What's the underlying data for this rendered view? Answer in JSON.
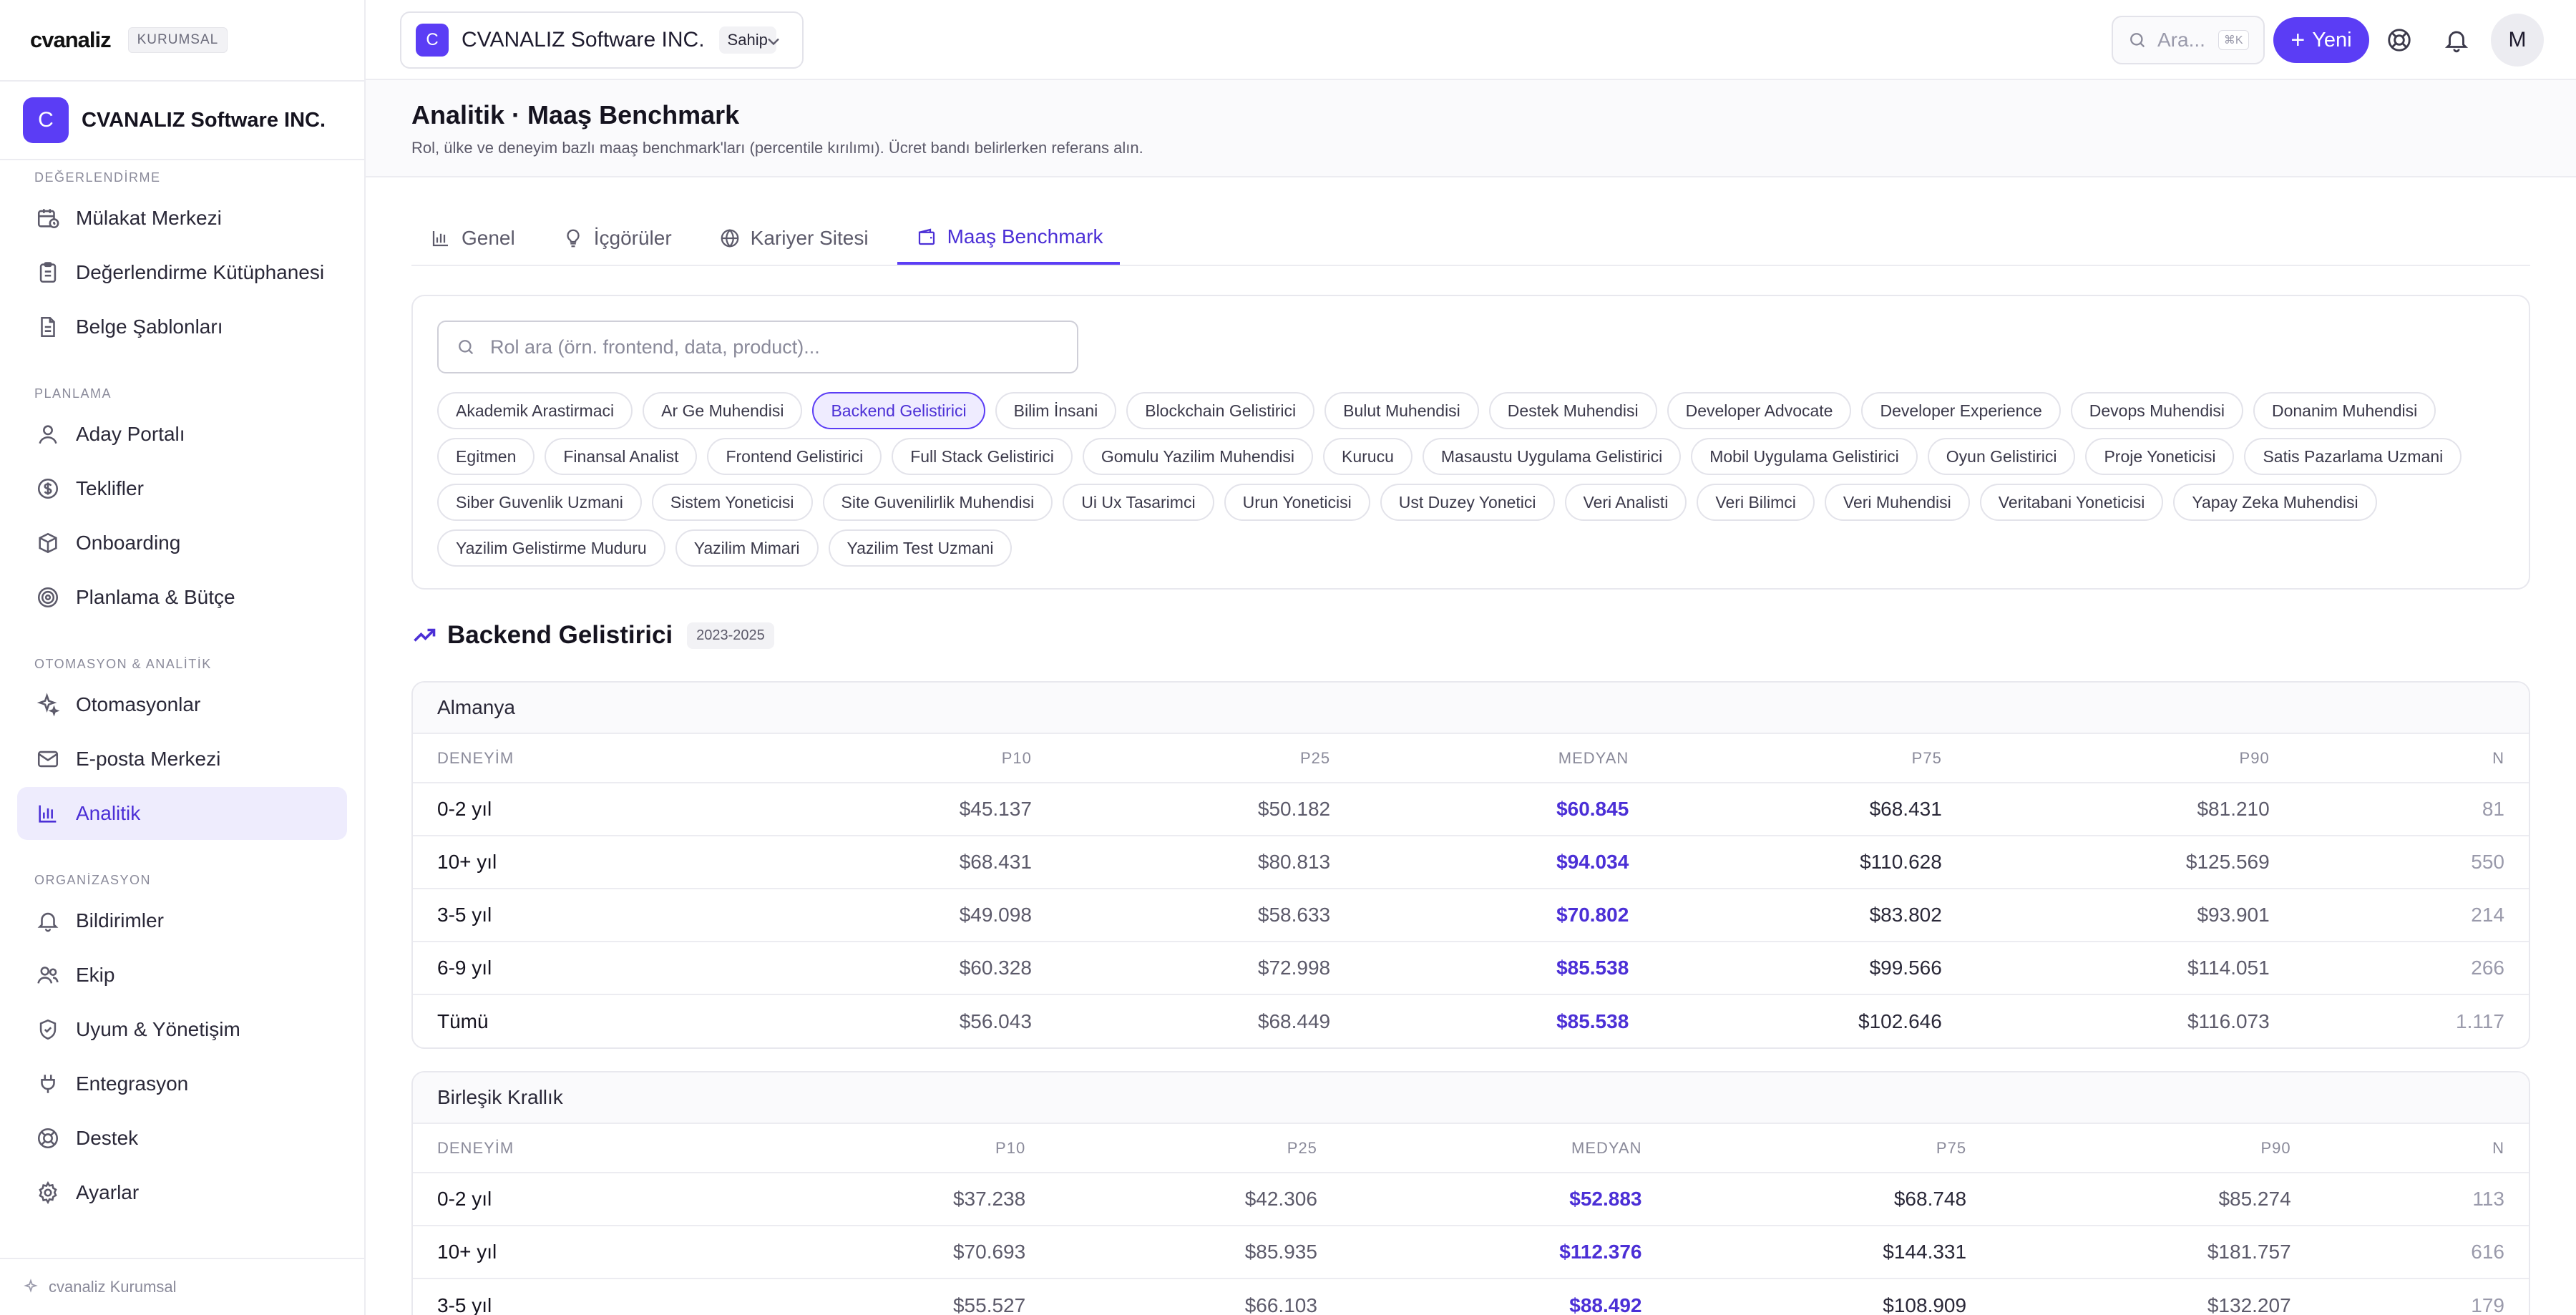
{
  "brand": {
    "logo": "cvanaliz",
    "badge": "KURUMSAL"
  },
  "org": {
    "initial": "C",
    "name": "CVANALIZ Software INC."
  },
  "sidebar": {
    "sections": [
      {
        "title": "DEĞERLENDİRME",
        "items": [
          {
            "label": "Mülakat Merkezi",
            "icon": "calendar-clock-icon"
          },
          {
            "label": "Değerlendirme Kütüphanesi",
            "icon": "clipboard-icon"
          },
          {
            "label": "Belge Şablonları",
            "icon": "document-icon"
          }
        ]
      },
      {
        "title": "PLANLAMA",
        "items": [
          {
            "label": "Aday Portalı",
            "icon": "user-icon"
          },
          {
            "label": "Teklifler",
            "icon": "dollar-circle-icon"
          },
          {
            "label": "Onboarding",
            "icon": "box-icon"
          },
          {
            "label": "Planlama & Bütçe",
            "icon": "target-icon"
          }
        ]
      },
      {
        "title": "OTOMASYON & ANALİTİK",
        "items": [
          {
            "label": "Otomasyonlar",
            "icon": "sparkles-icon"
          },
          {
            "label": "E-posta Merkezi",
            "icon": "mail-icon"
          },
          {
            "label": "Analitik",
            "icon": "bar-chart-icon",
            "active": true
          }
        ]
      },
      {
        "title": "ORGANİZASYON",
        "items": [
          {
            "label": "Bildirimler",
            "icon": "bell-icon"
          },
          {
            "label": "Ekip",
            "icon": "users-icon"
          },
          {
            "label": "Uyum & Yönetişim",
            "icon": "shield-icon"
          },
          {
            "label": "Entegrasyon",
            "icon": "plug-icon"
          },
          {
            "label": "Destek",
            "icon": "lifebuoy-icon"
          },
          {
            "label": "Ayarlar",
            "icon": "gear-icon"
          }
        ]
      }
    ],
    "footer": "cvanaliz Kurumsal"
  },
  "topbar": {
    "workspace_initial": "C",
    "workspace_name": "CVANALIZ Software INC.",
    "workspace_role": "Sahip",
    "search_placeholder": "Ara...",
    "search_shortcut": "⌘K",
    "new_label": "Yeni",
    "user_initial": "M"
  },
  "page": {
    "title": "Analitik · Maaş Benchmark",
    "subtitle": "Rol, ülke ve deneyim bazlı maaş benchmark'ları (percentile kırılımı). Ücret bandı belirlerken referans alın."
  },
  "tabs": [
    {
      "label": "Genel",
      "icon": "bar-chart-icon"
    },
    {
      "label": "İçgörüler",
      "icon": "lightbulb-icon"
    },
    {
      "label": "Kariyer Sitesi",
      "icon": "globe-icon"
    },
    {
      "label": "Maaş Benchmark",
      "icon": "wallet-icon",
      "active": true
    }
  ],
  "roles": {
    "search_placeholder": "Rol ara (örn. frontend, data, product)...",
    "selected": "Backend Gelistirici",
    "list": [
      "Akademik Arastirmaci",
      "Ar Ge Muhendisi",
      "Backend Gelistirici",
      "Bilim İnsani",
      "Blockchain Gelistirici",
      "Bulut Muhendisi",
      "Destek Muhendisi",
      "Developer Advocate",
      "Developer Experience",
      "Devops Muhendisi",
      "Donanim Muhendisi",
      "Egitmen",
      "Finansal Analist",
      "Frontend Gelistirici",
      "Full Stack Gelistirici",
      "Gomulu Yazilim Muhendisi",
      "Kurucu",
      "Masaustu Uygulama Gelistirici",
      "Mobil Uygulama Gelistirici",
      "Oyun Gelistirici",
      "Proje Yoneticisi",
      "Satis Pazarlama Uzmani",
      "Siber Guvenlik Uzmani",
      "Sistem Yoneticisi",
      "Site Guvenilirlik Muhendisi",
      "Ui Ux Tasarimci",
      "Urun Yoneticisi",
      "Ust Duzey Yonetici",
      "Veri Analisti",
      "Veri Bilimci",
      "Veri Muhendisi",
      "Veritabani Yoneticisi",
      "Yapay Zeka Muhendisi",
      "Yazilim Gelistirme Muduru",
      "Yazilim Mimari",
      "Yazilim Test Uzmani"
    ]
  },
  "benchmark": {
    "role_title": "Backend Gelistirici",
    "period": "2023-2025",
    "columns": [
      "DENEYİM",
      "P10",
      "P25",
      "MEDYAN",
      "P75",
      "P90",
      "N"
    ],
    "countries": [
      {
        "name": "Almanya",
        "rows": [
          [
            "0-2 yıl",
            "$45.137",
            "$50.182",
            "$60.845",
            "$68.431",
            "$81.210",
            "81"
          ],
          [
            "10+ yıl",
            "$68.431",
            "$80.813",
            "$94.034",
            "$110.628",
            "$125.569",
            "550"
          ],
          [
            "3-5 yıl",
            "$49.098",
            "$58.633",
            "$70.802",
            "$83.802",
            "$93.901",
            "214"
          ],
          [
            "6-9 yıl",
            "$60.328",
            "$72.998",
            "$85.538",
            "$99.566",
            "$114.051",
            "266"
          ],
          [
            "Tümü",
            "$56.043",
            "$68.449",
            "$85.538",
            "$102.646",
            "$116.073",
            "1.117"
          ]
        ]
      },
      {
        "name": "Birleşik Krallık",
        "rows": [
          [
            "0-2 yıl",
            "$37.238",
            "$42.306",
            "$52.883",
            "$68.748",
            "$85.274",
            "113"
          ],
          [
            "10+ yıl",
            "$70.693",
            "$85.935",
            "$112.376",
            "$144.331",
            "$181.757",
            "616"
          ],
          [
            "3-5 yıl",
            "$55.527",
            "$66.103",
            "$88.492",
            "$108.909",
            "$132.207",
            "179"
          ]
        ]
      }
    ]
  },
  "colors": {
    "accent": "#5b3df5",
    "accent_text": "#4b2fd6",
    "active_bg": "#eeecfd"
  }
}
